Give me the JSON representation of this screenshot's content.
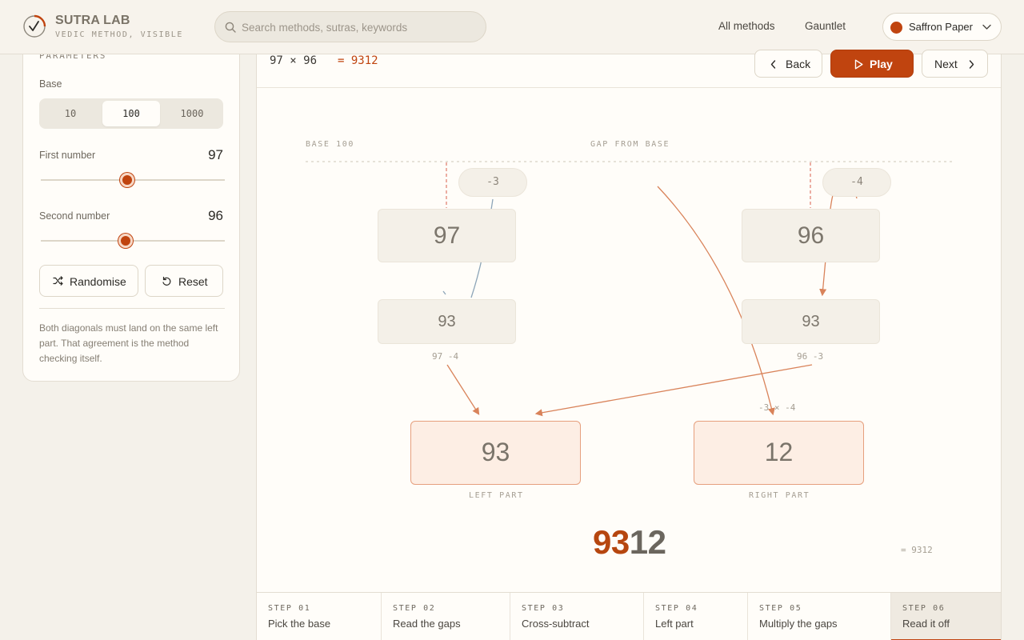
{
  "app": {
    "brand": "SUTRA LAB",
    "tagline": "VEDIC METHOD, VISIBLE"
  },
  "search": {
    "placeholder": "Search methods, sutras, keywords"
  },
  "nav": {
    "all_methods": "All methods",
    "gauntlet": "Gauntlet"
  },
  "theme": {
    "label": "Saffron Paper",
    "color": "#c0440f"
  },
  "sidebar": {
    "section_title": "PARAMETERS",
    "base_label": "Base",
    "base_options": [
      "10",
      "100",
      "1000"
    ],
    "base_selected": "100",
    "first_label": "First number",
    "first_value": "97",
    "second_label": "Second number",
    "second_value": "96",
    "randomise_label": "Randomise",
    "reset_label": "Reset",
    "note": "Both diagonals must land on the same left part. That agreement is the method checking itself."
  },
  "equation": {
    "text": "97 × 96",
    "result": "= 9312"
  },
  "controls": {
    "back": "Back",
    "play": "Play",
    "next": "Next"
  },
  "diagram": {
    "base_caption": "BASE 100",
    "gap_caption": "GAP FROM BASE",
    "first": "97",
    "second": "96",
    "first_gap": "-3",
    "second_gap": "-4",
    "cross_left": "93",
    "cross_right": "93",
    "cross_left_expr": "97 -4",
    "cross_right_expr": "96 -3",
    "product_expr": "-3 × -4",
    "left_part": "93",
    "right_part": "12",
    "left_caption": "LEFT PART",
    "right_caption": "RIGHT PART",
    "final_lead": "93",
    "final_tail": "12",
    "final_note": "= 9312"
  },
  "steps": [
    {
      "num": "STEP 01",
      "label": "Pick the base"
    },
    {
      "num": "STEP 02",
      "label": "Read the gaps"
    },
    {
      "num": "STEP 03",
      "label": "Cross-subtract"
    },
    {
      "num": "STEP 04",
      "label": "Left part"
    },
    {
      "num": "STEP 05",
      "label": "Multiply the gaps"
    },
    {
      "num": "STEP 06",
      "label": "Read it off"
    }
  ],
  "active_step": 6
}
